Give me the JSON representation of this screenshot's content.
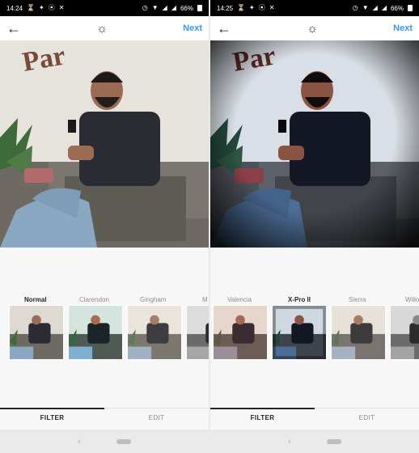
{
  "left": {
    "status": {
      "time": "14:24",
      "battery": "66%"
    },
    "header": {
      "next_label": "Next",
      "back_icon": "back-arrow-icon",
      "brightness_icon": "brightness-icon"
    },
    "filters": [
      "Normal",
      "Clarendon",
      "Gingham",
      "M"
    ],
    "selected_filter": "Normal",
    "tabs": {
      "filter": "FILTER",
      "edit": "EDIT"
    }
  },
  "right": {
    "status": {
      "time": "14:25",
      "battery": "66%"
    },
    "header": {
      "next_label": "Next",
      "back_icon": "back-arrow-icon",
      "brightness_icon": "brightness-icon"
    },
    "filters": [
      "Valencia",
      "X-Pro II",
      "Sierra",
      "Willo"
    ],
    "selected_filter": "X-Pro II",
    "tabs": {
      "filter": "FILTER",
      "edit": "EDIT"
    }
  },
  "colors": {
    "accent": "#3897f0",
    "text": "#262626",
    "muted": "#8e8e8e"
  }
}
